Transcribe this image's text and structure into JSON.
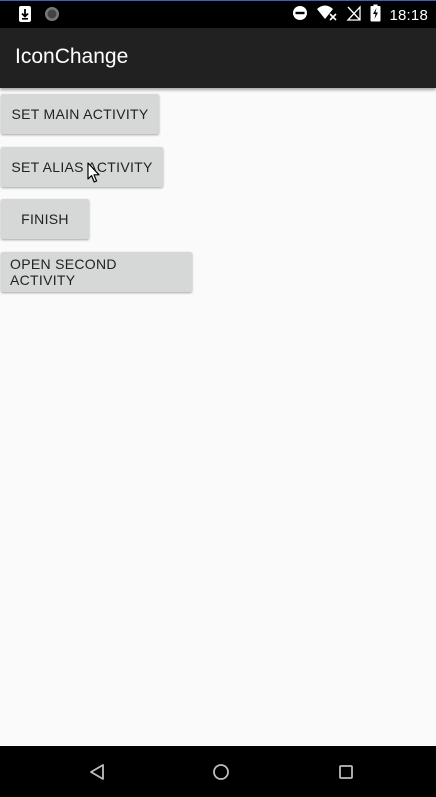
{
  "status_bar": {
    "time": "18:18",
    "left_icons": [
      "download-icon",
      "sync-icon"
    ],
    "right_icons": [
      "do-not-disturb-icon",
      "wifi-icon",
      "no-signal-icon",
      "battery-charging-icon"
    ]
  },
  "app_bar": {
    "title": "IconChange"
  },
  "buttons": [
    {
      "label": "SET MAIN ACTIVITY"
    },
    {
      "label": "SET ALIAS ACTIVITY"
    },
    {
      "label": "FINISH"
    },
    {
      "label": "OPEN SECOND ACTIVITY"
    }
  ],
  "nav_bar": {
    "icons": [
      "back-icon",
      "home-icon",
      "recents-icon"
    ]
  },
  "colors": {
    "app_bar": "#212121",
    "status_bar": "#000000",
    "background": "#fafafa",
    "button": "#d6d7d7"
  }
}
